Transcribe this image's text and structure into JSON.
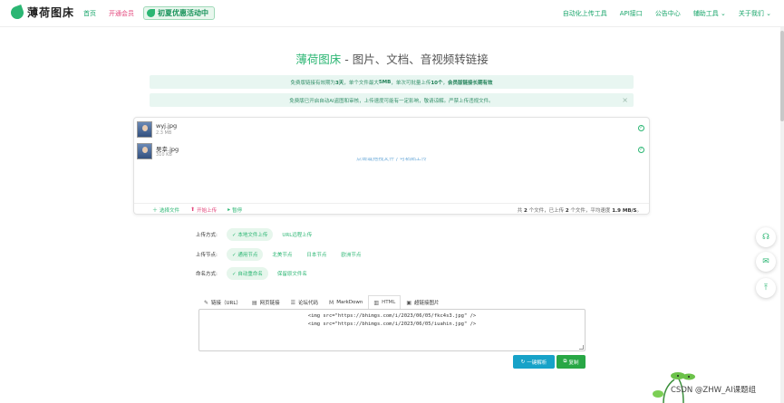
{
  "brand": {
    "name": "薄荷图床"
  },
  "nav_left": [
    {
      "label": "首页"
    },
    {
      "label": "开通会员"
    }
  ],
  "promo": {
    "label": "初夏优惠活动中"
  },
  "nav_right": [
    {
      "label": "自动化上传工具"
    },
    {
      "label": "API接口"
    },
    {
      "label": "公告中心"
    },
    {
      "label": "辅助工具 ⌄"
    },
    {
      "label": "关于我们 ⌄"
    }
  ],
  "heading": {
    "brand": "薄荷图床",
    "rest": " - 图片、文档、音视频转链接"
  },
  "notice1": {
    "pre": "免费版链接有效期为 ",
    "days": "3天",
    "mid1": "，单个文件最大 ",
    "size": "5MB",
    "mid2": "，单次可批量上传 ",
    "count": "10个",
    "sep": "，",
    "tail": "会员版链接长期有效"
  },
  "notice2": {
    "text": "免费版已开启自动AI盗图和审核，上传速度可能有一定影响，敬请谅解。严禁上传违规文件。",
    "close": "×"
  },
  "files": [
    {
      "name": "wyj.jpg",
      "size": "2.3 MB",
      "status": "✓"
    },
    {
      "name": "吴幸.jpg",
      "size": "310 KB",
      "status": "✓"
    }
  ],
  "drop_hint": "点击或拖拽文件 / 可粘贴上传",
  "card_actions": [
    {
      "icon": "＋",
      "label": "选择文件"
    },
    {
      "icon": "⬆",
      "label": "开始上传"
    },
    {
      "icon": "▸",
      "label": "暂停"
    }
  ],
  "stats": {
    "p1": "共 ",
    "total": "2",
    "p2": " 个文件，已上传 ",
    "done": "2",
    "p3": " 个文件，平均速度 ",
    "speed": "1.9 MB/S",
    "p4": "。"
  },
  "options": {
    "upload_mode": {
      "label": "上传方式:",
      "choices": [
        "✓ 本地文件上传",
        "URL远程上传"
      ]
    },
    "upload_node": {
      "label": "上传节点:",
      "choices": [
        "✓ 通用节点",
        "北美节点",
        "日本节点",
        "欧洲节点"
      ]
    },
    "naming": {
      "label": "命名方式:",
      "choices": [
        "✓ 自动重命名",
        "保留原文件名"
      ]
    }
  },
  "tabs": [
    {
      "icon": "✎",
      "label": "链接（URL）"
    },
    {
      "icon": "▤",
      "label": "网页链接"
    },
    {
      "icon": "☰",
      "label": "论坛代码"
    },
    {
      "icon": "M",
      "label": "MarkDown"
    },
    {
      "icon": "▥",
      "label": "HTML"
    },
    {
      "icon": "▣",
      "label": "超链接图片"
    }
  ],
  "output_lines": [
    "<img src=\"https://bhimgs.com/i/2023/06/05/fkc4s3.jpg\" />",
    "<img src=\"https://bhimgs.com/i/2023/06/05/iuahin.jpg\" />"
  ],
  "buttons": {
    "parse": {
      "icon": "↻",
      "label": "一键解析"
    },
    "copy": {
      "icon": "⧉",
      "label": "复制"
    }
  },
  "float_buttons": [
    {
      "icon": "headset-icon",
      "glyph": "☊"
    },
    {
      "icon": "wechat-icon",
      "glyph": "✉"
    },
    {
      "icon": "back-to-top-icon",
      "glyph": "⤒"
    }
  ],
  "watermark": "CSDN @ZHW_AI课题组",
  "colors": {
    "accent": "#2bb673",
    "pink": "#e3457b",
    "cyan": "#17a2c8",
    "green_btn": "#28a745"
  }
}
